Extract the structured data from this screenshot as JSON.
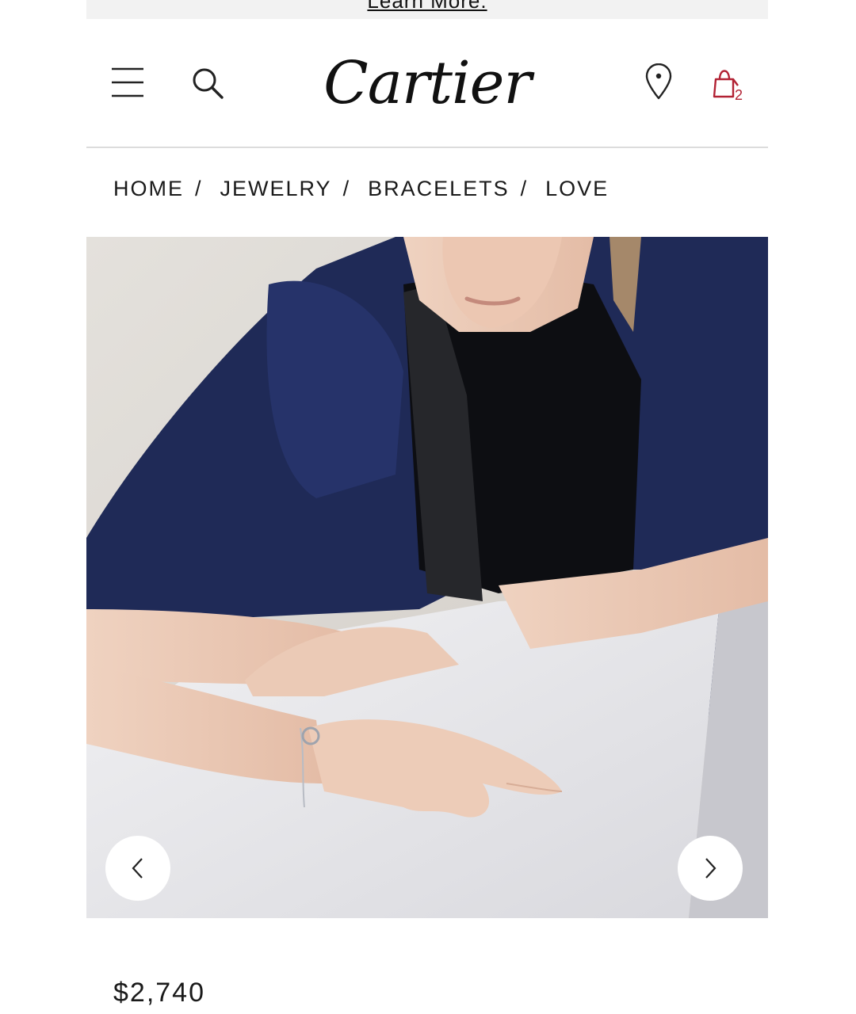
{
  "promo": {
    "link_text": "Learn More."
  },
  "header": {
    "logo_text": "Cartier",
    "menu_icon": "hamburger-menu-icon",
    "search_icon": "search-icon",
    "location_icon": "location-pin-icon",
    "bag_icon": "shopping-bag-icon",
    "bag_count": "2",
    "bag_color": "#b22234"
  },
  "breadcrumb": {
    "items": [
      "HOME",
      "JEWELRY",
      "BRACELETS",
      "LOVE"
    ],
    "separator": "/"
  },
  "gallery": {
    "prev_icon": "chevron-left-icon",
    "next_icon": "chevron-right-icon"
  },
  "product": {
    "price": "$2,740"
  }
}
